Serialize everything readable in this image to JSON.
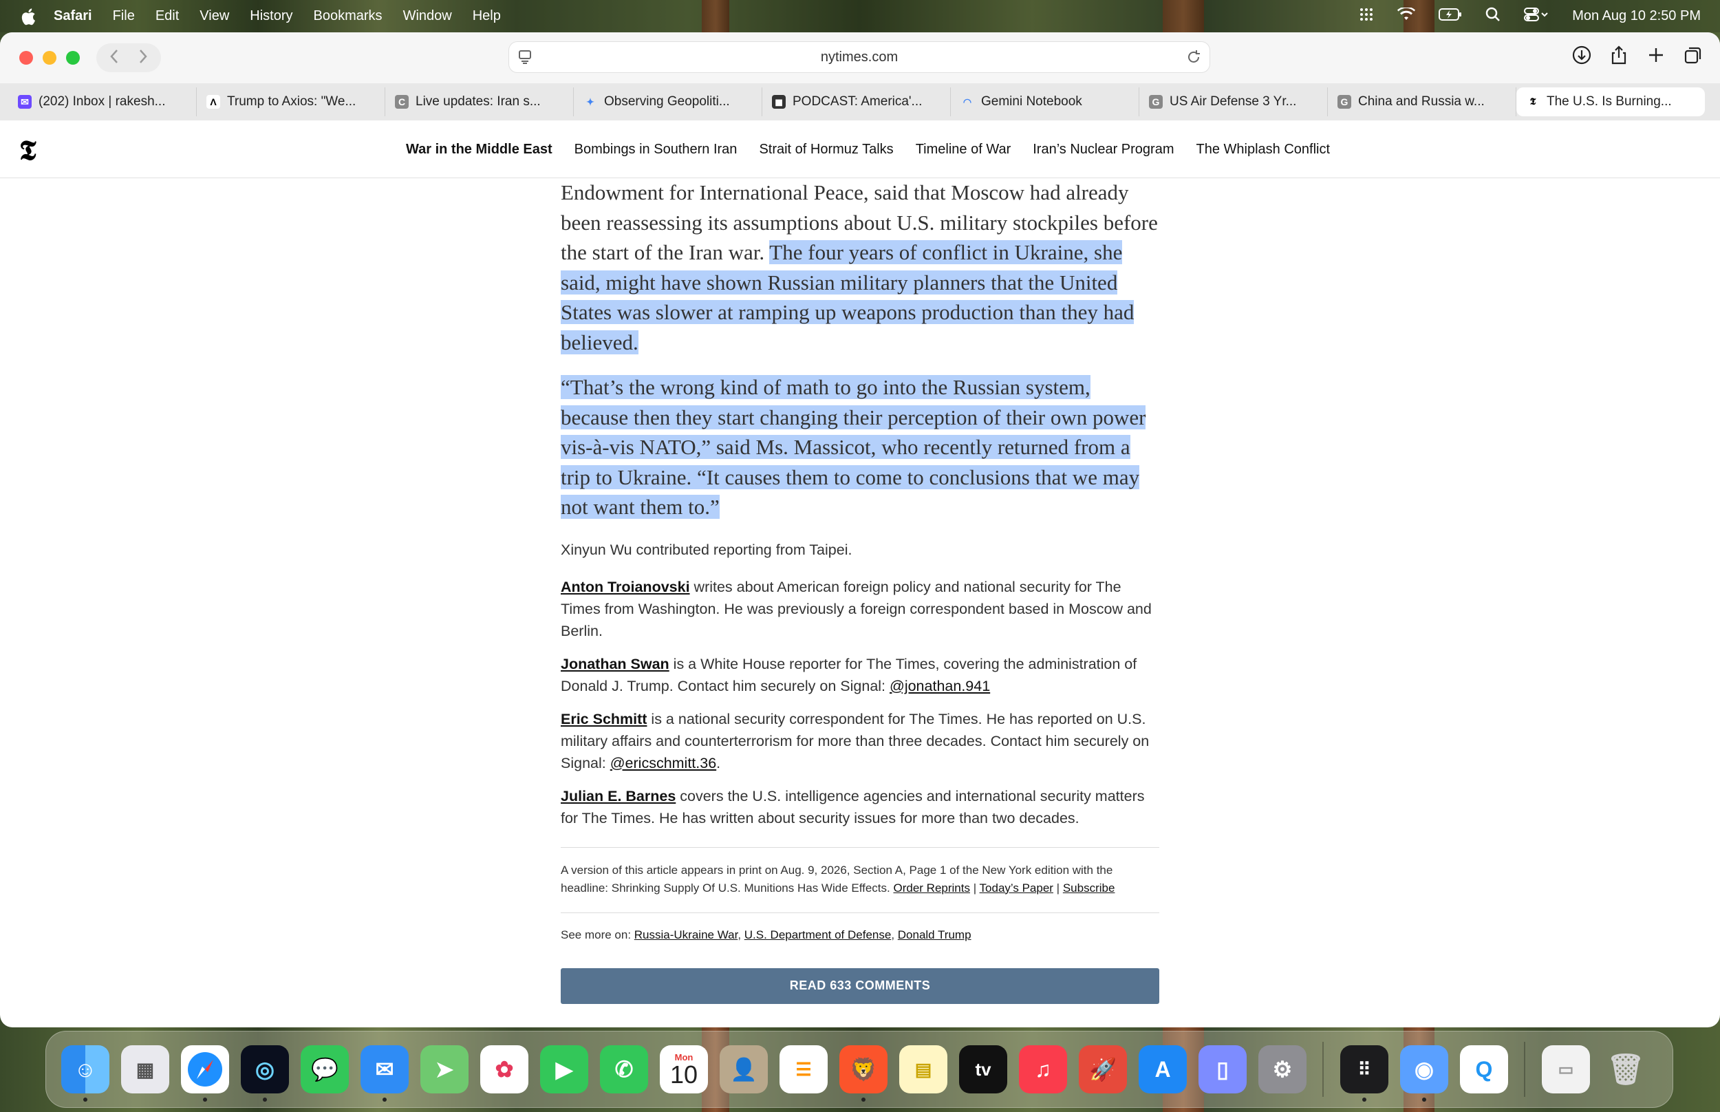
{
  "menubar": {
    "app": "Safari",
    "items": [
      "File",
      "Edit",
      "View",
      "History",
      "Bookmarks",
      "Window",
      "Help"
    ],
    "datetime": "Mon Aug 10  2:50 PM"
  },
  "browser": {
    "url": "nytimes.com",
    "tabs": [
      {
        "title": "(202) Inbox | rakesh...",
        "icon": "proton-mail-icon",
        "color": "#6d4aff"
      },
      {
        "title": "Trump to Axios: \"We...",
        "icon": "axios-icon",
        "color": "#000000"
      },
      {
        "title": "Live updates: Iran s...",
        "icon": "c-icon",
        "color": "#888888"
      },
      {
        "title": "Observing Geopoliti...",
        "icon": "gemini-sparkle-icon",
        "color": "#4285f4"
      },
      {
        "title": "PODCAST: America'...",
        "icon": "cube-icon",
        "color": "#333333"
      },
      {
        "title": "Gemini Notebook",
        "icon": "notebook-icon",
        "color": "#4285f4"
      },
      {
        "title": "US Air Defense 3 Yr...",
        "icon": "g-icon",
        "color": "#888888"
      },
      {
        "title": "China and Russia w...",
        "icon": "g-icon",
        "color": "#888888"
      },
      {
        "title": "The U.S. Is Burning...",
        "icon": "nyt-icon",
        "color": "#000000"
      }
    ]
  },
  "nyt_nav": {
    "logo": "𝕿",
    "links": [
      "War in the Middle East",
      "Bombings in Southern Iran",
      "Strait of Hormuz Talks",
      "Timeline of War",
      "Iran’s Nuclear Program",
      "The Whiplash Conflict"
    ]
  },
  "article": {
    "p1_plain": "Endowment for International Peace, said that Moscow had already been reassessing its assumptions about U.S. military stockpiles before the start of the Iran war. ",
    "p1_highlight": "The four years of conflict in Ukraine, she said, might have shown Russian military planners that the United States was slower at ramping up weapons production than they had believed.",
    "p2_highlight": "“That’s the wrong kind of math to go into the Russian system, because then they start changing their perception of their own power vis-à-vis NATO,” said Ms. Massicot, who recently returned from a trip to Ukraine. “It causes them to come to conclusions that we may not want them to.”",
    "contrib": "Xinyun Wu contributed reporting from Taipei.",
    "bylines": [
      {
        "name": "Anton Troianovski",
        "text": " writes about American foreign policy and national security for The Times from Washington. He was previously a foreign correspondent based in Moscow and Berlin.",
        "signal": "",
        "end": ""
      },
      {
        "name": "Jonathan Swan",
        "text": " is a White House reporter for The Times, covering the administration of Donald J. Trump. Contact him securely on Signal: ",
        "signal": "@jonathan.941",
        "end": ""
      },
      {
        "name": "Eric Schmitt",
        "text": " is a national security correspondent for The Times. He has reported on U.S. military affairs and counterterrorism for more than three decades. Contact him securely on Signal: ",
        "signal": "@ericschmitt.36",
        "end": "."
      },
      {
        "name": "Julian E. Barnes",
        "text": " covers the U.S. intelligence agencies and international security matters for The Times. He has written about security issues for more than two decades.",
        "signal": "",
        "end": ""
      }
    ],
    "print_note": "A version of this article appears in print on Aug. 9, 2026, Section A, Page 1 of the New York edition with the headline: Shrinking Supply Of U.S. Munitions Has Wide Effects. ",
    "order_reprints": "Order Reprints",
    "todays_paper": "Today’s Paper",
    "subscribe": "Subscribe",
    "sep": " | ",
    "see_more_label": "See more on: ",
    "see_more_links": [
      "Russia-Ukraine War",
      "U.S. Department of Defense",
      "Donald Trump"
    ],
    "comma": ", ",
    "read_comments": "READ 633 COMMENTS"
  },
  "dock": {
    "calendar_month": "Mon",
    "calendar_day": "10",
    "tv_label": "tv"
  }
}
